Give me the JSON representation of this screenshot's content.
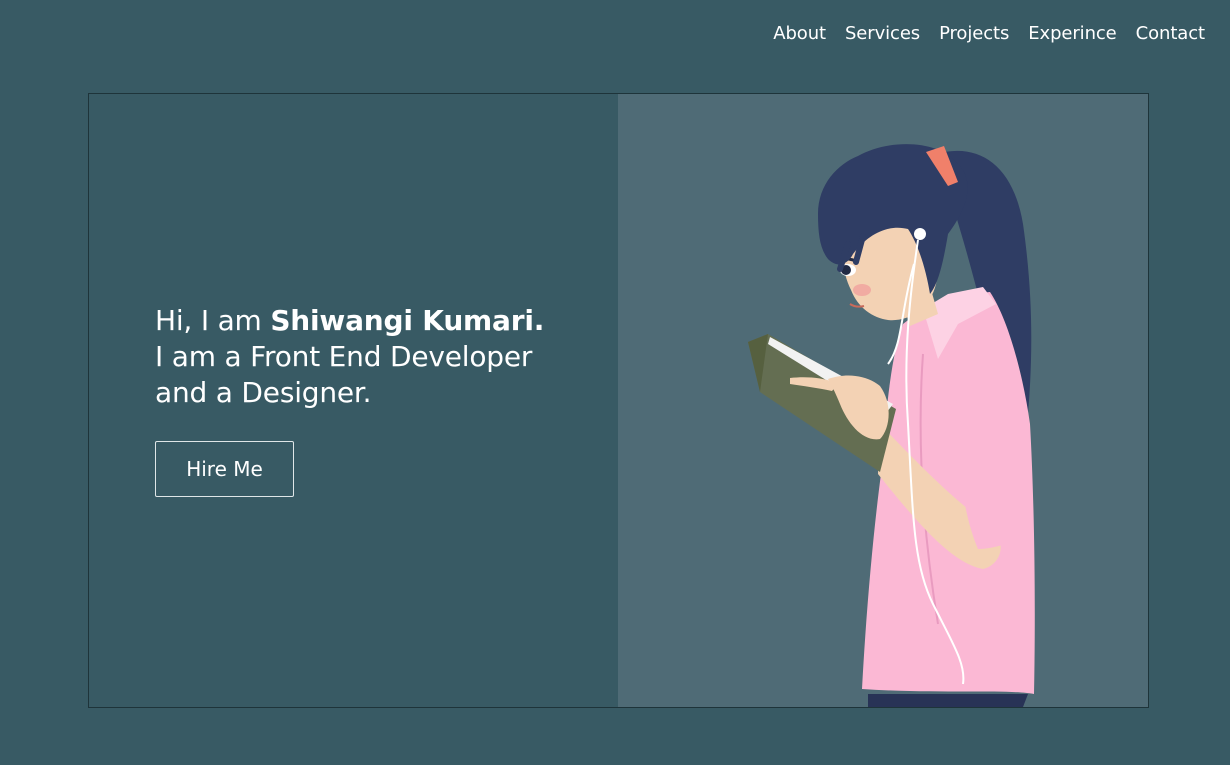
{
  "nav": {
    "items": [
      {
        "label": "About"
      },
      {
        "label": "Services"
      },
      {
        "label": "Projects"
      },
      {
        "label": "Experince"
      },
      {
        "label": "Contact"
      }
    ]
  },
  "hero": {
    "greeting_prefix": "Hi, I am ",
    "name": "Shiwangi Kumari.",
    "line2": "I am a Front End Developer",
    "line3": "and a Designer.",
    "cta_label": "Hire Me",
    "illustration_icon": "girl-reading-book-illustration"
  },
  "colors": {
    "background": "#385a64",
    "illustration_panel": "#4f6b76",
    "text": "#ffffff",
    "shirt": "#fbb8d4",
    "hair": "#2f3d64",
    "book": "#646e52"
  }
}
